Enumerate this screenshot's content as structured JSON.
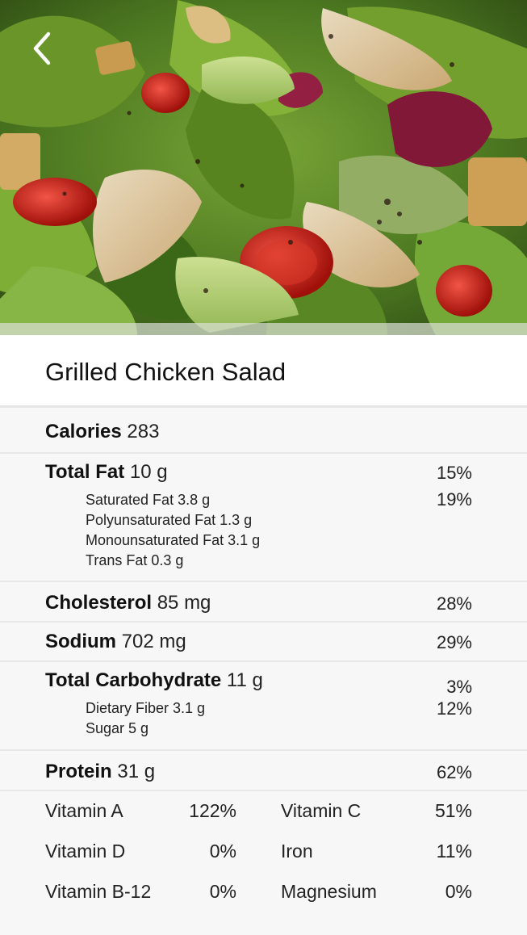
{
  "nav": {
    "back_icon": "chevron-left-icon"
  },
  "recipe": {
    "title": "Grilled Chicken Salad"
  },
  "nutrition": {
    "calories": {
      "label": "Calories",
      "value": "283"
    },
    "total_fat": {
      "label": "Total Fat",
      "value": "10 g",
      "pct": "15%",
      "sub": [
        {
          "text": "Saturated Fat 3.8 g",
          "pct": "19%"
        },
        {
          "text": "Polyunsaturated Fat 1.3 g",
          "pct": ""
        },
        {
          "text": "Monounsaturated Fat 3.1 g",
          "pct": ""
        },
        {
          "text": "Trans Fat 0.3 g",
          "pct": ""
        }
      ]
    },
    "cholesterol": {
      "label": "Cholesterol",
      "value": "85 mg",
      "pct": "28%"
    },
    "sodium": {
      "label": "Sodium",
      "value": "702 mg",
      "pct": "29%"
    },
    "total_carb": {
      "label": "Total Carbohydrate",
      "value": "11 g",
      "pct": "3%",
      "sub": [
        {
          "text": "Dietary Fiber 3.1 g",
          "pct": "12%"
        },
        {
          "text": "Sugar 5 g",
          "pct": ""
        }
      ]
    },
    "protein": {
      "label": "Protein",
      "value": "31 g",
      "pct": "62%"
    },
    "vitamins": [
      {
        "name": "Vitamin A",
        "value": "122%"
      },
      {
        "name": "Vitamin C",
        "value": "51%"
      },
      {
        "name": "Vitamin D",
        "value": "0%"
      },
      {
        "name": "Iron",
        "value": "11%"
      },
      {
        "name": "Vitamin B-12",
        "value": "0%"
      },
      {
        "name": "Magnesium",
        "value": "0%"
      }
    ]
  }
}
